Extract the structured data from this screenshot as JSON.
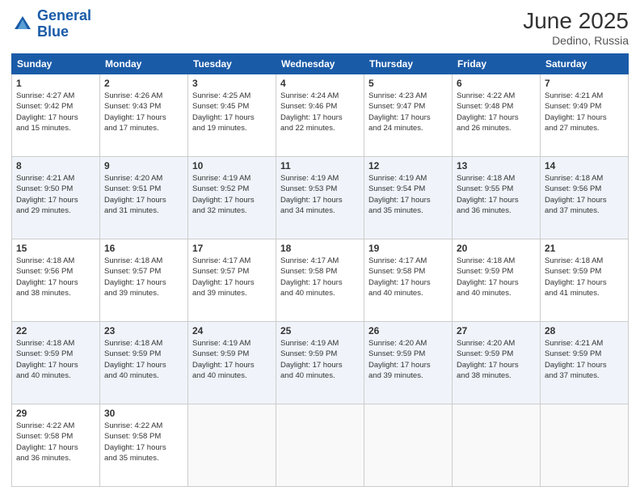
{
  "header": {
    "logo_general": "General",
    "logo_blue": "Blue",
    "month_year": "June 2025",
    "location": "Dedino, Russia"
  },
  "columns": [
    "Sunday",
    "Monday",
    "Tuesday",
    "Wednesday",
    "Thursday",
    "Friday",
    "Saturday"
  ],
  "weeks": [
    [
      {
        "day": "1",
        "info": "Sunrise: 4:27 AM\nSunset: 9:42 PM\nDaylight: 17 hours\nand 15 minutes."
      },
      {
        "day": "2",
        "info": "Sunrise: 4:26 AM\nSunset: 9:43 PM\nDaylight: 17 hours\nand 17 minutes."
      },
      {
        "day": "3",
        "info": "Sunrise: 4:25 AM\nSunset: 9:45 PM\nDaylight: 17 hours\nand 19 minutes."
      },
      {
        "day": "4",
        "info": "Sunrise: 4:24 AM\nSunset: 9:46 PM\nDaylight: 17 hours\nand 22 minutes."
      },
      {
        "day": "5",
        "info": "Sunrise: 4:23 AM\nSunset: 9:47 PM\nDaylight: 17 hours\nand 24 minutes."
      },
      {
        "day": "6",
        "info": "Sunrise: 4:22 AM\nSunset: 9:48 PM\nDaylight: 17 hours\nand 26 minutes."
      },
      {
        "day": "7",
        "info": "Sunrise: 4:21 AM\nSunset: 9:49 PM\nDaylight: 17 hours\nand 27 minutes."
      }
    ],
    [
      {
        "day": "8",
        "info": "Sunrise: 4:21 AM\nSunset: 9:50 PM\nDaylight: 17 hours\nand 29 minutes."
      },
      {
        "day": "9",
        "info": "Sunrise: 4:20 AM\nSunset: 9:51 PM\nDaylight: 17 hours\nand 31 minutes."
      },
      {
        "day": "10",
        "info": "Sunrise: 4:19 AM\nSunset: 9:52 PM\nDaylight: 17 hours\nand 32 minutes."
      },
      {
        "day": "11",
        "info": "Sunrise: 4:19 AM\nSunset: 9:53 PM\nDaylight: 17 hours\nand 34 minutes."
      },
      {
        "day": "12",
        "info": "Sunrise: 4:19 AM\nSunset: 9:54 PM\nDaylight: 17 hours\nand 35 minutes."
      },
      {
        "day": "13",
        "info": "Sunrise: 4:18 AM\nSunset: 9:55 PM\nDaylight: 17 hours\nand 36 minutes."
      },
      {
        "day": "14",
        "info": "Sunrise: 4:18 AM\nSunset: 9:56 PM\nDaylight: 17 hours\nand 37 minutes."
      }
    ],
    [
      {
        "day": "15",
        "info": "Sunrise: 4:18 AM\nSunset: 9:56 PM\nDaylight: 17 hours\nand 38 minutes."
      },
      {
        "day": "16",
        "info": "Sunrise: 4:18 AM\nSunset: 9:57 PM\nDaylight: 17 hours\nand 39 minutes."
      },
      {
        "day": "17",
        "info": "Sunrise: 4:17 AM\nSunset: 9:57 PM\nDaylight: 17 hours\nand 39 minutes."
      },
      {
        "day": "18",
        "info": "Sunrise: 4:17 AM\nSunset: 9:58 PM\nDaylight: 17 hours\nand 40 minutes."
      },
      {
        "day": "19",
        "info": "Sunrise: 4:17 AM\nSunset: 9:58 PM\nDaylight: 17 hours\nand 40 minutes."
      },
      {
        "day": "20",
        "info": "Sunrise: 4:18 AM\nSunset: 9:59 PM\nDaylight: 17 hours\nand 40 minutes."
      },
      {
        "day": "21",
        "info": "Sunrise: 4:18 AM\nSunset: 9:59 PM\nDaylight: 17 hours\nand 41 minutes."
      }
    ],
    [
      {
        "day": "22",
        "info": "Sunrise: 4:18 AM\nSunset: 9:59 PM\nDaylight: 17 hours\nand 40 minutes."
      },
      {
        "day": "23",
        "info": "Sunrise: 4:18 AM\nSunset: 9:59 PM\nDaylight: 17 hours\nand 40 minutes."
      },
      {
        "day": "24",
        "info": "Sunrise: 4:19 AM\nSunset: 9:59 PM\nDaylight: 17 hours\nand 40 minutes."
      },
      {
        "day": "25",
        "info": "Sunrise: 4:19 AM\nSunset: 9:59 PM\nDaylight: 17 hours\nand 40 minutes."
      },
      {
        "day": "26",
        "info": "Sunrise: 4:20 AM\nSunset: 9:59 PM\nDaylight: 17 hours\nand 39 minutes."
      },
      {
        "day": "27",
        "info": "Sunrise: 4:20 AM\nSunset: 9:59 PM\nDaylight: 17 hours\nand 38 minutes."
      },
      {
        "day": "28",
        "info": "Sunrise: 4:21 AM\nSunset: 9:59 PM\nDaylight: 17 hours\nand 37 minutes."
      }
    ],
    [
      {
        "day": "29",
        "info": "Sunrise: 4:22 AM\nSunset: 9:58 PM\nDaylight: 17 hours\nand 36 minutes."
      },
      {
        "day": "30",
        "info": "Sunrise: 4:22 AM\nSunset: 9:58 PM\nDaylight: 17 hours\nand 35 minutes."
      },
      {
        "day": "",
        "info": ""
      },
      {
        "day": "",
        "info": ""
      },
      {
        "day": "",
        "info": ""
      },
      {
        "day": "",
        "info": ""
      },
      {
        "day": "",
        "info": ""
      }
    ]
  ]
}
